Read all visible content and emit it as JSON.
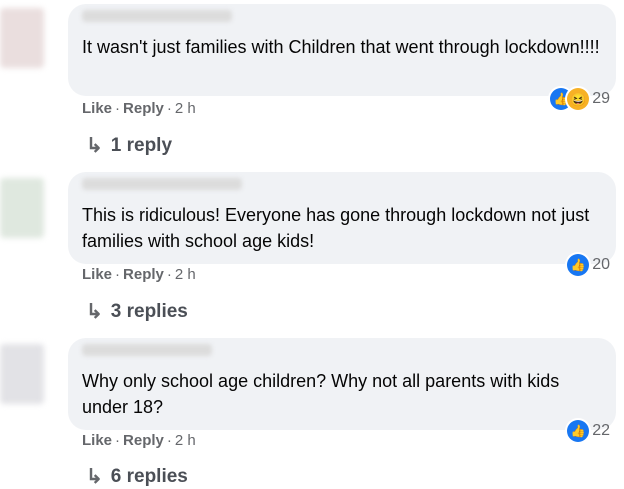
{
  "comments": [
    {
      "text": "It wasn't just families with Children that went through lockdown!!!!",
      "actions": {
        "like": "Like",
        "reply": "Reply",
        "time": "2 h"
      },
      "reactions": {
        "types": [
          "like",
          "haha"
        ],
        "count": "29"
      },
      "replies_label": "1 reply"
    },
    {
      "text": "This is ridiculous! Everyone has gone through lockdown not just families with school age kids!",
      "actions": {
        "like": "Like",
        "reply": "Reply",
        "time": "2 h"
      },
      "reactions": {
        "types": [
          "like"
        ],
        "count": "20"
      },
      "replies_label": "3 replies"
    },
    {
      "text": "Why only school age children? Why not all parents with kids under 18?",
      "actions": {
        "like": "Like",
        "reply": "Reply",
        "time": "2 h"
      },
      "reactions": {
        "types": [
          "like"
        ],
        "count": "22"
      },
      "replies_label": "6 replies"
    }
  ],
  "colors": {
    "bubble": "#f0f2f5",
    "like": "#1877f2",
    "haha": "#f7b125",
    "meta": "#65676b"
  }
}
